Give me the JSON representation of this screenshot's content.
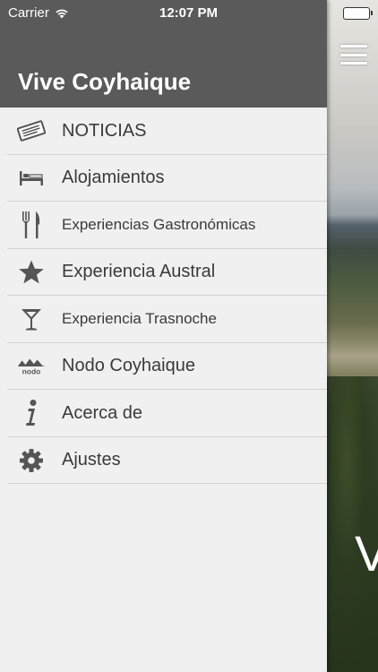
{
  "status_bar": {
    "carrier": "Carrier",
    "time": "12:07 PM"
  },
  "drawer": {
    "title": "Vive Coyhaique",
    "items": [
      {
        "label": "NOTICIAS",
        "icon": "newspaper-icon"
      },
      {
        "label": "Alojamientos",
        "icon": "bed-icon"
      },
      {
        "label": "Experiencias Gastronómicas",
        "icon": "fork-knife-icon"
      },
      {
        "label": "Experiencia Austral",
        "icon": "star-icon"
      },
      {
        "label": "Experiencia Trasnoche",
        "icon": "cocktail-glass-icon"
      },
      {
        "label": "Nodo Coyhaique",
        "icon": "nodo-logo-icon"
      },
      {
        "label": "Acerca de",
        "icon": "info-icon"
      },
      {
        "label": "Ajustes",
        "icon": "gear-icon"
      }
    ]
  },
  "background": {
    "partial_text": "V"
  },
  "colors": {
    "header_bg": "#5a5a5a",
    "drawer_bg": "#f0f0f0",
    "text": "#3a3a3a",
    "icon": "#555555"
  }
}
